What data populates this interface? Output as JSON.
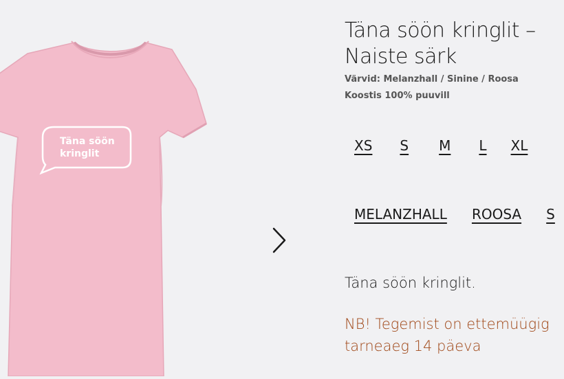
{
  "product": {
    "title_line1": "Täna söön kringlit –",
    "title_line2": "Naiste särk",
    "colors_line": "Värvid: Melanzhall / Sinine / Roosa",
    "composition_line": "Koostis 100% puuvill",
    "sizes": [
      "XS",
      "S",
      "M",
      "L",
      "XL"
    ],
    "color_options": [
      "MELANZHALL",
      "ROOSA",
      "S"
    ],
    "description": "Täna söön kringlit.",
    "notice_line1": "NB! Tegemist on ettemüügig",
    "notice_line2": "tarneaeg 14 päeva"
  },
  "image": {
    "print_line1": "Täna söön",
    "print_line2": "kringlit",
    "shirt_color": "#f3bccb",
    "shirt_shade": "#e8a9ba"
  },
  "gallery": {
    "next_icon": "chevron-right-icon"
  },
  "colors": {
    "background": "#f1f1f3",
    "notice": "#a04818"
  }
}
